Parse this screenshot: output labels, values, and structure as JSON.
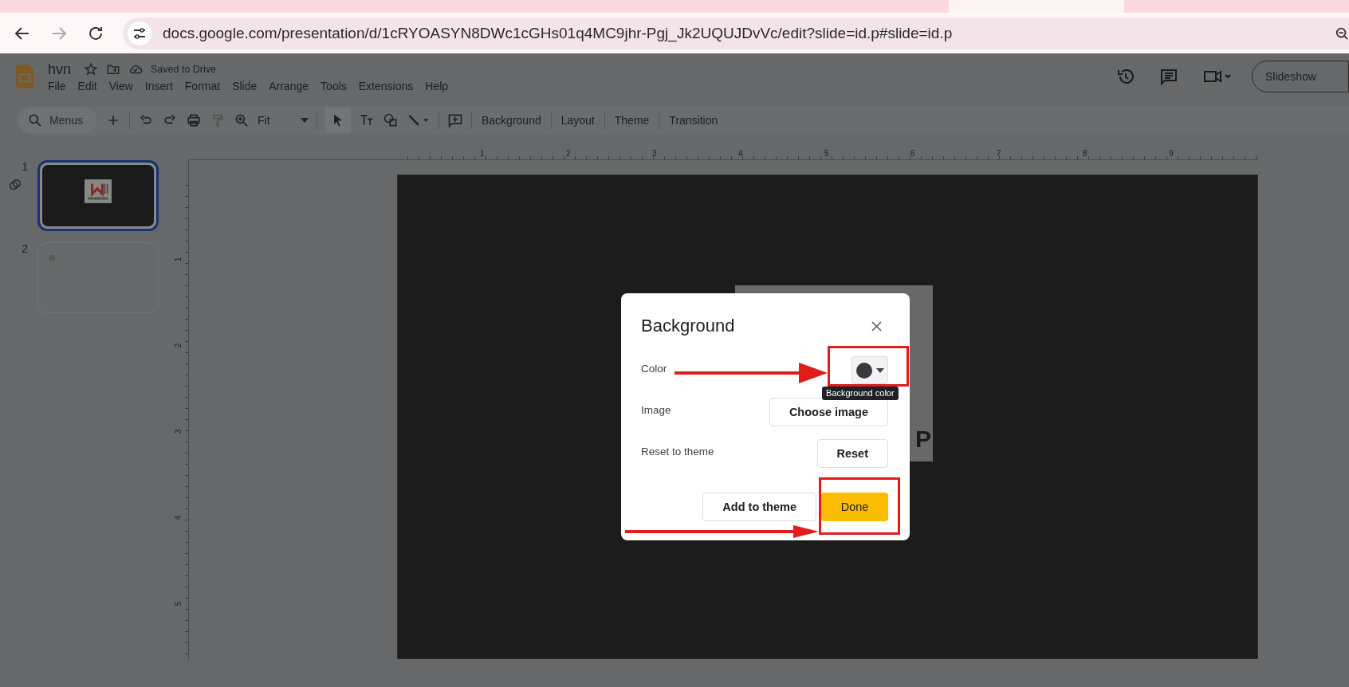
{
  "browser": {
    "url": "docs.google.com/presentation/d/1cRYOASYN8DWc1cGHs01q4MC9jhr-Pgj_Jk2UQUJDvVc/edit?slide=id.p#slide=id.p"
  },
  "doc": {
    "title": "hvn",
    "status": "Saved to Drive",
    "menus": [
      "File",
      "Edit",
      "View",
      "Insert",
      "Format",
      "Slide",
      "Arrange",
      "Tools",
      "Extensions",
      "Help"
    ],
    "slideshow": "Slideshow"
  },
  "toolbar": {
    "search_placeholder": "Menus",
    "zoom": "Fit",
    "buttons": [
      "Background",
      "Layout",
      "Theme",
      "Transition"
    ]
  },
  "slides": [
    {
      "number": "1",
      "selected": true,
      "kind": "dark"
    },
    {
      "number": "2",
      "selected": false,
      "kind": "blank"
    }
  ],
  "ruler": {
    "horizontal": [
      "1",
      "2",
      "3",
      "4",
      "5",
      "6",
      "7",
      "8",
      "9"
    ],
    "vertical": [
      "1",
      "2",
      "3",
      "4",
      "5"
    ]
  },
  "slide_text_fragment": "P",
  "dialog": {
    "title": "Background",
    "rows": [
      {
        "label": "Color",
        "kind": "color"
      },
      {
        "label": "Image",
        "kind": "button",
        "button": "Choose image"
      },
      {
        "label": "Reset to theme",
        "kind": "button",
        "button": "Reset"
      }
    ],
    "tooltip": "Background color",
    "secondary_button": "Add to theme",
    "primary_button": "Done"
  }
}
